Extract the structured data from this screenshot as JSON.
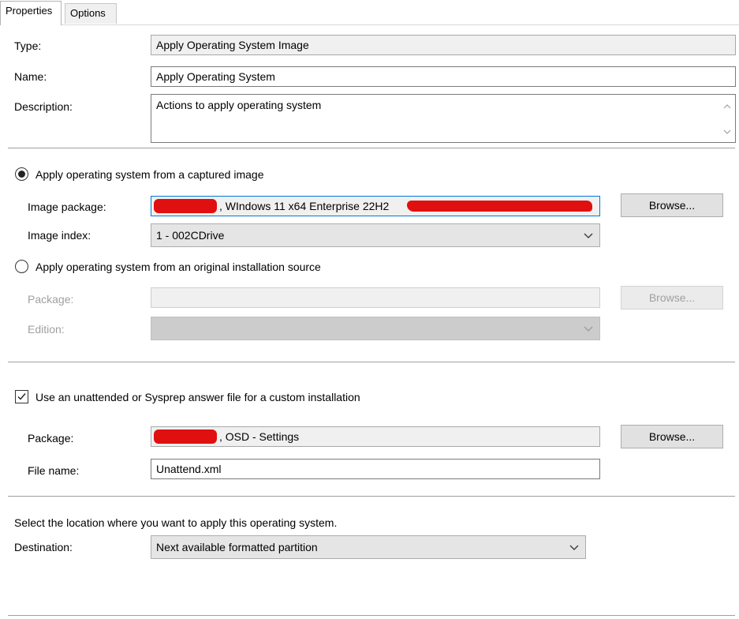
{
  "tabs": [
    {
      "label": "Properties",
      "active": true
    },
    {
      "label": "Options",
      "active": false
    }
  ],
  "general": {
    "type_label": "Type:",
    "type_value": "Apply Operating System Image",
    "name_label": "Name:",
    "name_value": "Apply Operating System",
    "description_label": "Description:",
    "description_value": "Actions to apply operating system"
  },
  "captured_image": {
    "option_label": "Apply operating system from a captured image",
    "selected": true,
    "image_package_label": "Image package:",
    "image_package_value": ", WIndows 11 x64 Enterprise 22H2",
    "browse_label": "Browse...",
    "image_index_label": "Image index:",
    "image_index_value": "1 - 002CDrive"
  },
  "original_source": {
    "option_label": "Apply operating system from an original installation source",
    "selected": false,
    "package_label": "Package:",
    "package_value": "",
    "browse_label": "Browse...",
    "edition_label": "Edition:",
    "edition_value": ""
  },
  "answer_file": {
    "checkbox_label": "Use an unattended or Sysprep answer file for a custom installation",
    "checked": true,
    "package_label": "Package:",
    "package_value": ", OSD - Settings",
    "browse_label": "Browse...",
    "filename_label": "File name:",
    "filename_value": "Unattend.xml"
  },
  "destination": {
    "instruction": "Select the location where you want to apply this operating system.",
    "label": "Destination:",
    "value": "Next available formatted partition"
  },
  "colors": {
    "focus_border": "#0078d7",
    "redaction": "#e01010"
  }
}
